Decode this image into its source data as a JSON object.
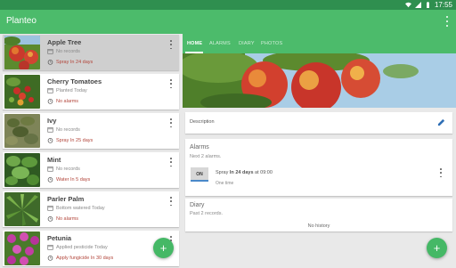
{
  "status_bar": {
    "time": "17:55"
  },
  "app": {
    "title": "Planteo",
    "accent": "#4cbb6b"
  },
  "plants": [
    {
      "name": "Apple Tree",
      "info": "No records",
      "alarm": "Spray In 24 days",
      "selected": true
    },
    {
      "name": "Cherry Tomatoes",
      "info": "Planted Today",
      "alarm": "No alarms"
    },
    {
      "name": "Ivy",
      "info": "No records",
      "alarm": "Spray In 25 days"
    },
    {
      "name": "Mint",
      "info": "No records",
      "alarm": "Water In 5 days"
    },
    {
      "name": "Parler Palm",
      "info": "Bottom watered Today",
      "alarm": "No alarms"
    },
    {
      "name": "Petunia",
      "info": "Applied pesticide Today",
      "alarm": "Apply fungicide In 30 days"
    }
  ],
  "tabs": [
    "HOME",
    "ALARMS",
    "DIARY",
    "PHOTOS"
  ],
  "details": {
    "description_label": "Description",
    "alarms": {
      "heading": "Alarms",
      "subheading": "Next 2 alarms.",
      "toggle_label": "ON",
      "alarm_action": "Spray",
      "alarm_when": "In 24 days",
      "alarm_time": "at 09:00",
      "alarm_frequency": "One time"
    },
    "diary": {
      "heading": "Diary",
      "subheading": "Past 2 records.",
      "empty_text": "No history"
    }
  },
  "fab_label": "+"
}
